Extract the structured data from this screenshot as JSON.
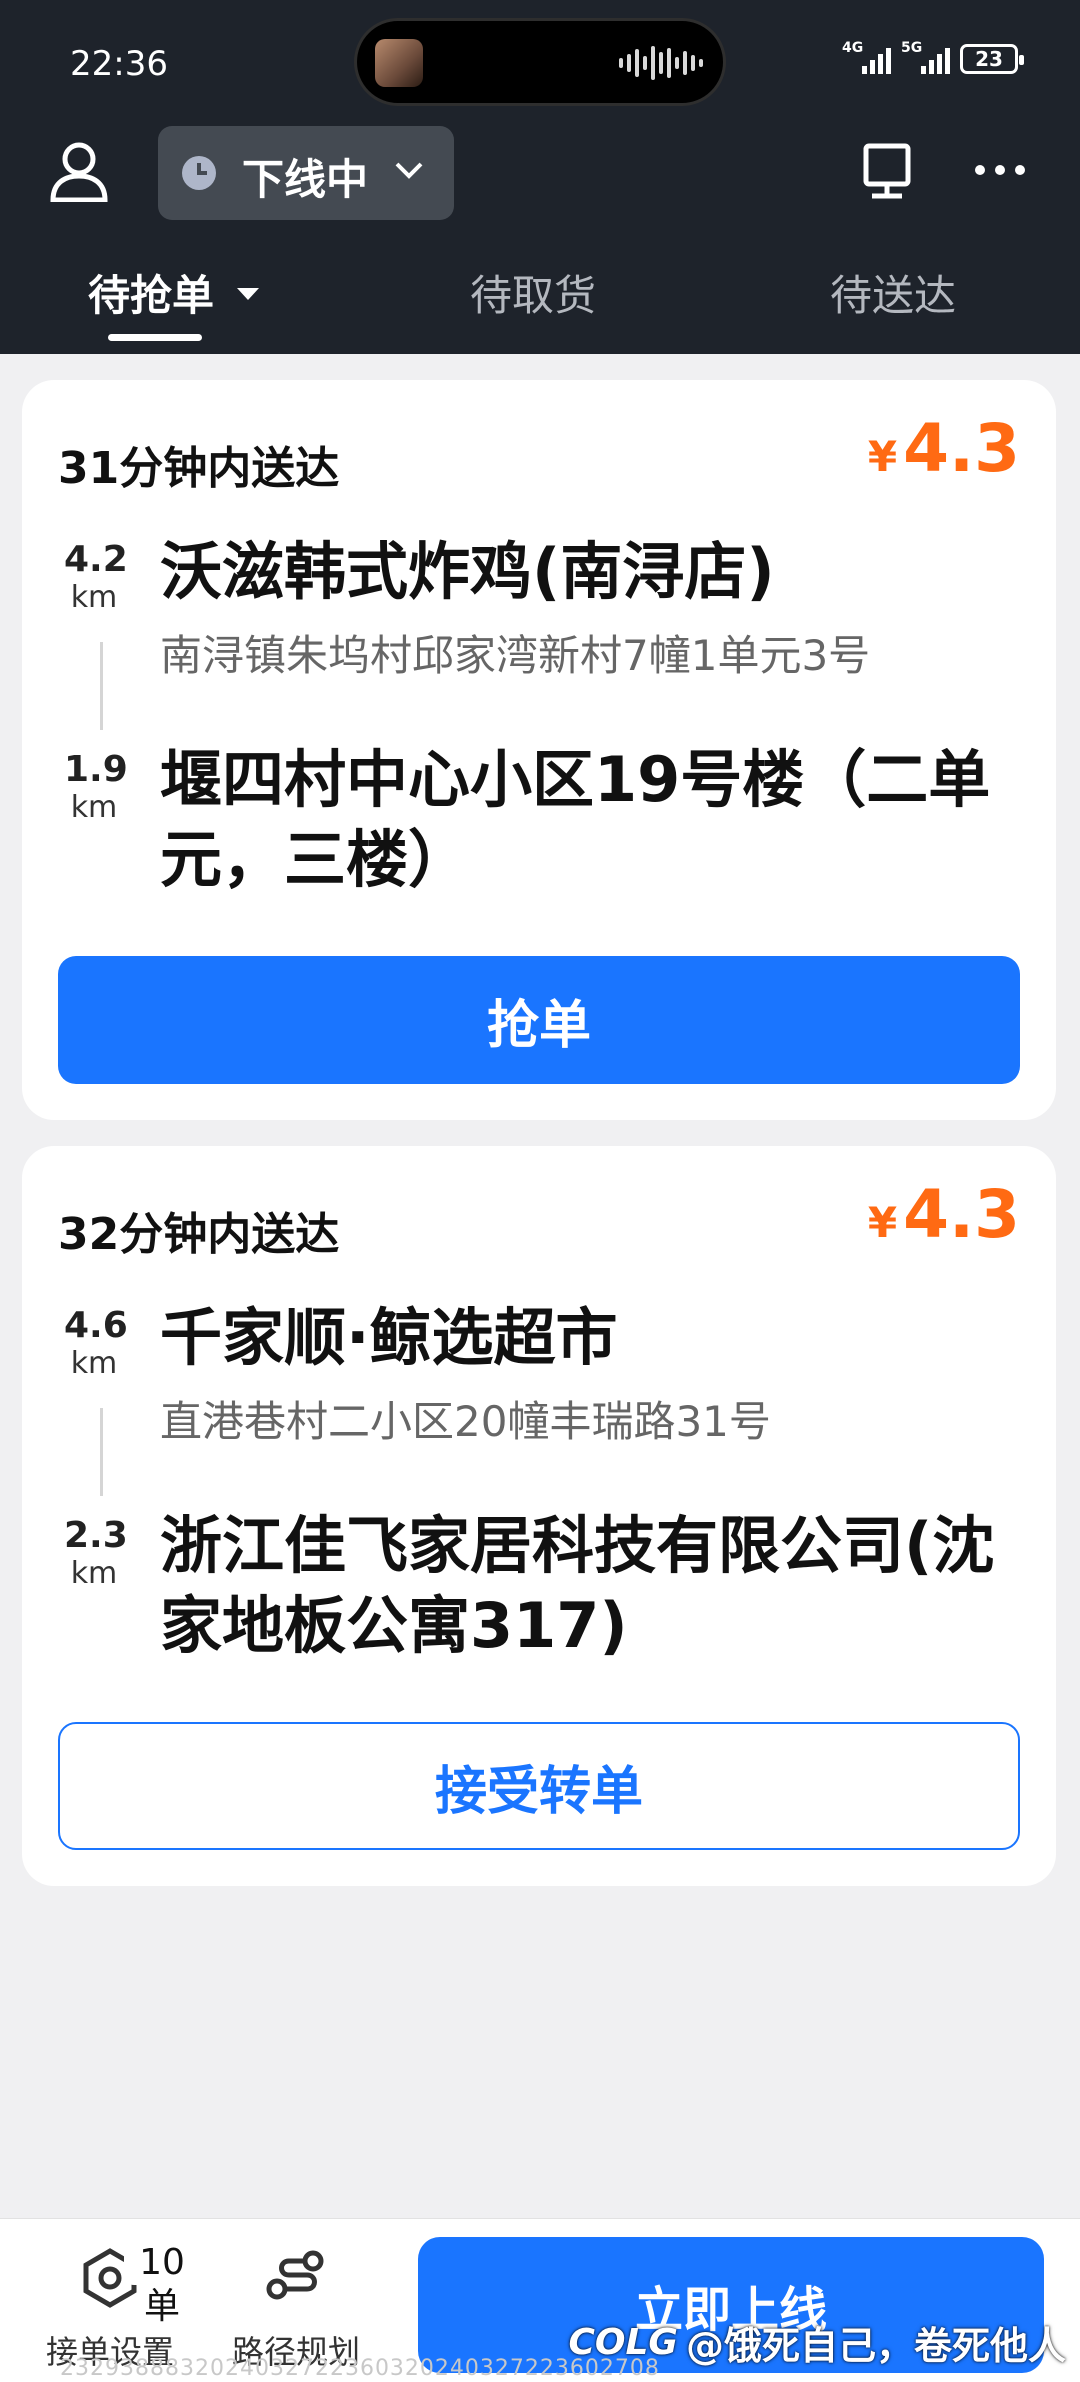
{
  "status_bar": {
    "time": "22:36",
    "network_1": "4G",
    "network_2": "5G",
    "battery": "23"
  },
  "header": {
    "status_label": "下线中"
  },
  "tabs": [
    {
      "label": "待抢单",
      "active": true
    },
    {
      "label": "待取货",
      "active": false
    },
    {
      "label": "待送达",
      "active": false
    }
  ],
  "orders": [
    {
      "eta": "31分钟内送达",
      "currency": "¥",
      "price": "4.3",
      "pickup": {
        "distance": "4.2",
        "unit": "km",
        "name": "沃滋韩式炸鸡(南浔店)",
        "address": "南浔镇朱坞村邱家湾新村7幢1单元3号"
      },
      "dropoff": {
        "distance": "1.9",
        "unit": "km",
        "name": "堰四村中心小区19号楼（二单元，三楼）"
      },
      "action": "抢单"
    },
    {
      "eta": "32分钟内送达",
      "currency": "¥",
      "price": "4.3",
      "pickup": {
        "distance": "4.6",
        "unit": "km",
        "name": "千家顺·鲸选超市",
        "address": "直港巷村二小区20幢丰瑞路31号"
      },
      "dropoff": {
        "distance": "2.3",
        "unit": "km",
        "name": "浙江佳飞家居科技有限公司(沈家地板公寓317)"
      },
      "action": "接受转单"
    }
  ],
  "bottom_bar": {
    "settings_badge": "10单",
    "settings_label": "接单设置",
    "route_label": "路径规划",
    "go_online": "立即上线",
    "watermark_handle": "@饿死自己，卷死他人",
    "watermark_logo": "COLG",
    "footer_code": "23293888320240327223603202403272236027​08"
  },
  "colors": {
    "header_bg": "#1e232b",
    "primary": "#1a75ff",
    "price": "#ff6a13",
    "page_bg": "#f0f0f2"
  },
  "icons": [
    "user-icon",
    "clock-icon",
    "chevron-down-icon",
    "scan-icon",
    "more-icon",
    "order-settings-icon",
    "route-icon"
  ]
}
